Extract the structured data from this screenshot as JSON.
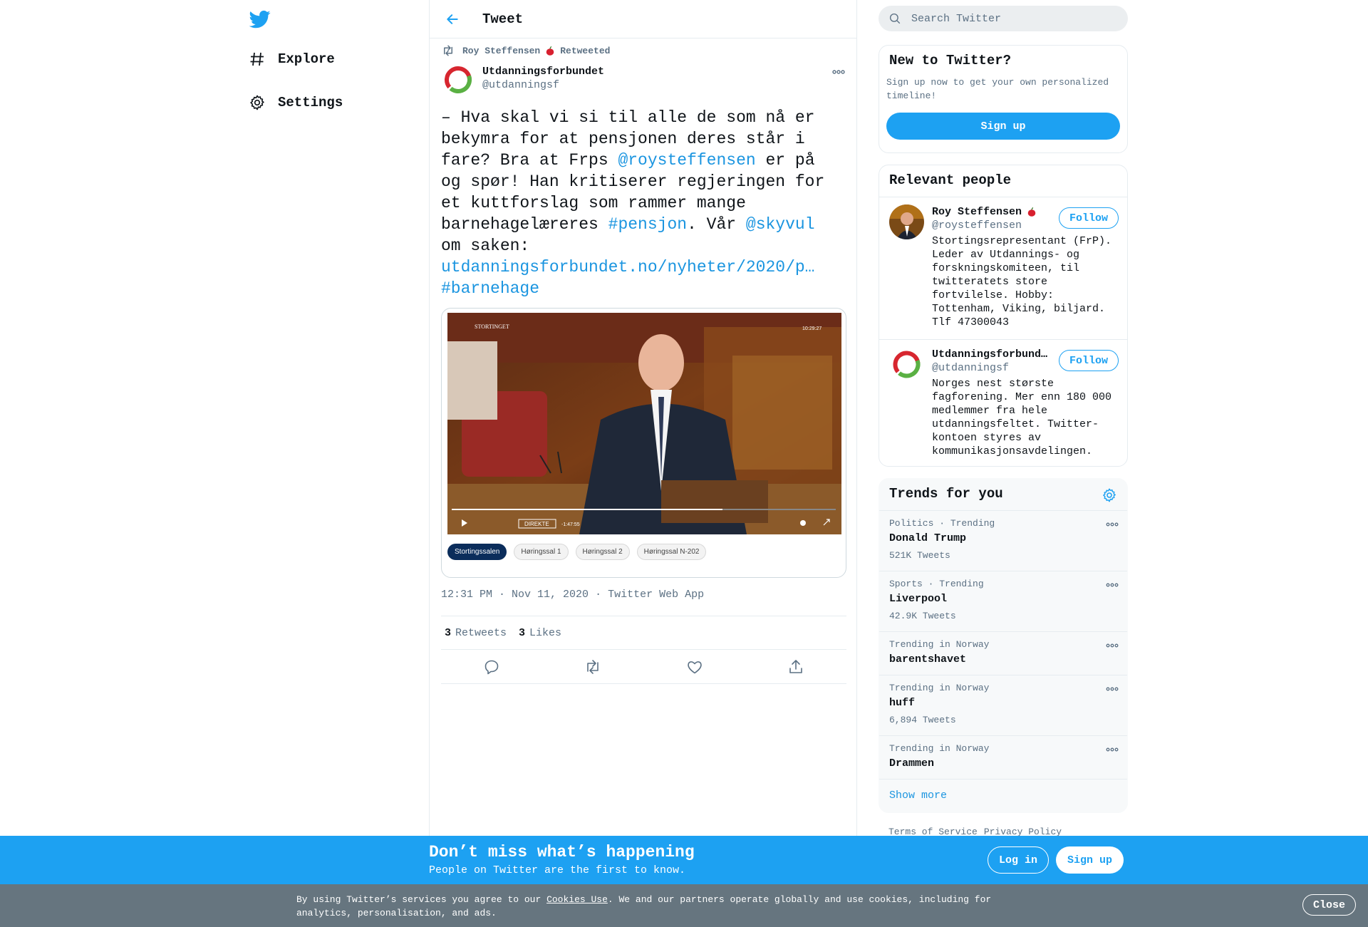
{
  "nav": {
    "items": [
      {
        "label": "Explore",
        "icon": "hashtag-icon"
      },
      {
        "label": "Settings",
        "icon": "gear-icon"
      }
    ]
  },
  "header": {
    "title": "Tweet"
  },
  "tweet": {
    "retweeted_by": "Roy Steffensen",
    "retweeted_label": "Retweeted",
    "author_name": "Utdanningsforbundet",
    "author_handle": "@utdanningsf",
    "text_parts": {
      "p1": "– Hva skal vi si til alle de som nå er bekymra for at pensjonen deres står i fare? Bra at Frps ",
      "m1": "@roysteffensen",
      "p2": " er på og spør! Han kritiserer regjeringen for et kuttforslag som rammer mange barnehagelæreres ",
      "h1": "#pensjon",
      "p3": ". Vår ",
      "m2": "@skyvul",
      "p4": " om saken: ",
      "url": "utdanningsforbundet.no/nyheter/2020/p…",
      "h2": "#barnehage"
    },
    "media": {
      "logo_text": "STORTINGET",
      "clock": "10:29:27",
      "live_label": "DIREKTE",
      "remaining": "-1:47:55",
      "chips": [
        "Stortingssalen",
        "Høringssal 1",
        "Høringssal 2",
        "Høringssal N-202"
      ]
    },
    "time": "12:31 PM",
    "date": "Nov 11, 2020",
    "source": "Twitter Web App",
    "retweets": "3",
    "retweets_label": "Retweets",
    "likes": "3",
    "likes_label": "Likes"
  },
  "search": {
    "placeholder": "Search Twitter"
  },
  "new_to_twitter": {
    "title": "New to Twitter?",
    "subtitle": "Sign up now to get your own personalized timeline!",
    "button": "Sign up"
  },
  "relevant_people": {
    "title": "Relevant people",
    "people": [
      {
        "name": "Roy Steffensen",
        "handle": "@roysteffensen",
        "bio": "Stortingsrepresentant (FrP). Leder av Utdannings- og forskningskomiteen, til twitteratets store fortvilelse. Hobby: Tottenham, Viking, biljard. Tlf 47300043",
        "follow": "Follow"
      },
      {
        "name": "Utdanningsforbundet",
        "handle": "@utdanningsf",
        "bio": "Norges nest største fagforening. Mer enn 180 000 medlemmer fra hele utdanningsfeltet. Twitter-kontoen styres av kommunikasjonsavdelingen.",
        "follow": "Follow"
      }
    ]
  },
  "trends": {
    "title": "Trends for you",
    "items": [
      {
        "meta": "Politics · Trending",
        "name": "Donald Trump",
        "count": "521K Tweets"
      },
      {
        "meta": "Sports · Trending",
        "name": "Liverpool",
        "count": "42.9K Tweets"
      },
      {
        "meta": "Trending in Norway",
        "name": "barentshavet",
        "count": ""
      },
      {
        "meta": "Trending in Norway",
        "name": "huff",
        "count": "6,894 Tweets"
      },
      {
        "meta": "Trending in Norway",
        "name": "Drammen",
        "count": ""
      }
    ],
    "show_more": "Show more"
  },
  "footer": {
    "terms": "Terms of Service",
    "privacy": "Privacy Policy"
  },
  "signup_bar": {
    "title": "Don’t miss what’s happening",
    "subtitle": "People on Twitter are the first to know.",
    "login": "Log in",
    "signup": "Sign up"
  },
  "cookie": {
    "text_before": "By using Twitter’s services you agree to our ",
    "link": "Cookies Use",
    "text_after": ". We and our partners operate globally and use cookies, including for analytics, personalisation, and ads.",
    "close": "Close"
  },
  "colors": {
    "accent": "#1da1f2",
    "link": "#1b95e0",
    "cookie_bg": "#66757f"
  }
}
